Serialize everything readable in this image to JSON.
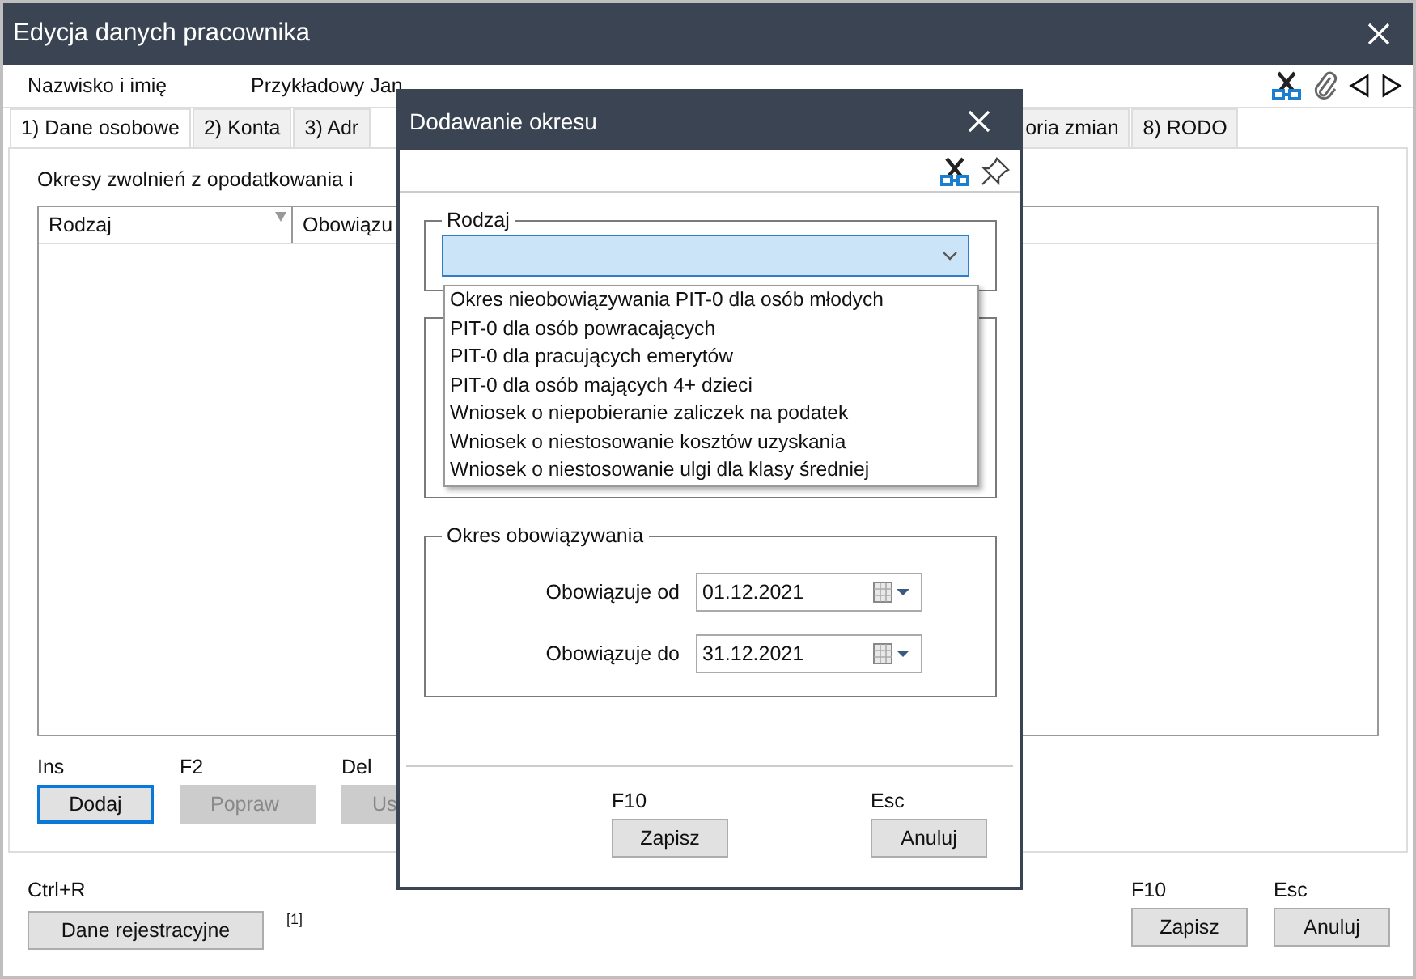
{
  "window": {
    "title": "Edycja danych pracownika"
  },
  "header": {
    "label": "Nazwisko i imię",
    "value": "Przykładowy Jan"
  },
  "tabs": [
    {
      "label": "1) Dane osobowe",
      "selected": true
    },
    {
      "label": "2) Konta",
      "selected": false
    },
    {
      "label": "3) Adr",
      "selected": false
    },
    {
      "label": "oria zmian",
      "selected": false
    },
    {
      "label": "8) RODO",
      "selected": false
    }
  ],
  "section": {
    "title": "Okresy zwolnień z opodatkowania i",
    "columns": [
      "Rodzaj",
      "Obowiązu"
    ]
  },
  "actions": [
    {
      "shortcut": "Ins",
      "label": "Dodaj",
      "disabled": false,
      "focused": true
    },
    {
      "shortcut": "F2",
      "label": "Popraw",
      "disabled": true,
      "focused": false
    },
    {
      "shortcut": "Del",
      "label": "Us",
      "disabled": true,
      "focused": false
    }
  ],
  "footer": {
    "shortcut": "Ctrl+R",
    "button": "Dane rejestracyjne",
    "note": "[1]",
    "buttons": [
      {
        "shortcut": "F10",
        "label": "Zapisz"
      },
      {
        "shortcut": "Esc",
        "label": "Anuluj"
      }
    ]
  },
  "dialog": {
    "title": "Dodawanie okresu",
    "group1": "Rodzaj",
    "options": [
      {
        "label": "Okres nieobowiązywania PIT-0 dla osób młodych",
        "selected": false
      },
      {
        "label": "PIT-0 dla osób powracających",
        "selected": false
      },
      {
        "label": "PIT-0 dla pracujących emerytów",
        "selected": false
      },
      {
        "label": "PIT-0 dla osób mających 4+ dzieci",
        "selected": false
      },
      {
        "label": "Wniosek o niepobieranie zaliczek na podatek",
        "selected": false
      },
      {
        "label": "Wniosek o niestosowanie kosztów uzyskania",
        "selected": false
      },
      {
        "label": "Wniosek o niestosowanie ulgi dla klasy średniej",
        "selected": false
      }
    ],
    "group2": "Okres obowiązywania",
    "dates": [
      {
        "label": "Obowiązuje od",
        "value": "01.12.2021"
      },
      {
        "label": "Obowiązuje do",
        "value": "31.12.2021"
      }
    ],
    "buttons": [
      {
        "shortcut": "F10",
        "label": "Zapisz"
      },
      {
        "shortcut": "Esc",
        "label": "Anuluj"
      }
    ]
  }
}
